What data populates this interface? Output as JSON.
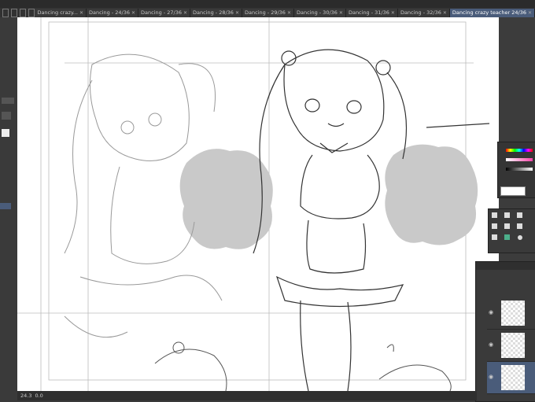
{
  "tabs": [
    {
      "label": "Dancing crazy..."
    },
    {
      "label": "Dancing - 24/36"
    },
    {
      "label": "Dancing - 27/36"
    },
    {
      "label": "Dancing - 28/36"
    },
    {
      "label": "Dancing - 29/36"
    },
    {
      "label": "Dancing - 30/36"
    },
    {
      "label": "Dancing - 31/36"
    },
    {
      "label": "Dancing - 32/36"
    },
    {
      "label": "Dancing crazy teacher 24/36",
      "active": true
    }
  ],
  "status": {
    "zoom": "24.3",
    "angle": "0.0"
  },
  "colors": {
    "accent": "#4a5c7a",
    "ui_dark": "#2b2b2b",
    "panel": "#3a3a3a",
    "canvas": "#ffffff",
    "pom": "#c9c9c9"
  },
  "icons": [
    "close-icon",
    "eye-icon",
    "pen-icon",
    "eraser-icon",
    "fill-icon",
    "move-icon",
    "lasso-icon"
  ]
}
